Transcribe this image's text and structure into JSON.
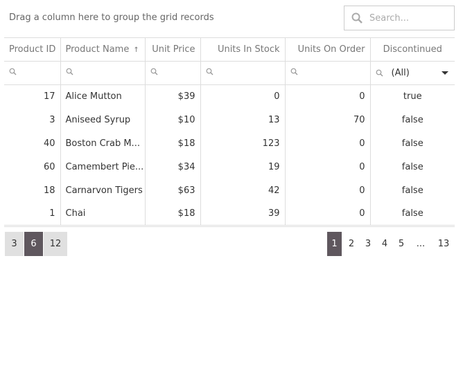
{
  "group_panel": {
    "text": "Drag a column here to group the grid records"
  },
  "search": {
    "placeholder": "Search..."
  },
  "columns": [
    "Product ID",
    "Product Name",
    "Unit Price",
    "Units In Stock",
    "Units On Order",
    "Discontinued"
  ],
  "sort": {
    "column": "Product Name",
    "direction": "ascending"
  },
  "filter": {
    "discontinued": "(All)"
  },
  "rows": [
    [
      "17",
      "Alice Mutton",
      "$39",
      "0",
      "0",
      "true"
    ],
    [
      "3",
      "Aniseed Syrup",
      "$10",
      "13",
      "70",
      "false"
    ],
    [
      "40",
      "Boston Crab M...",
      "$18",
      "123",
      "0",
      "false"
    ],
    [
      "60",
      "Camembert Pie...",
      "$34",
      "19",
      "0",
      "false"
    ],
    [
      "18",
      "Carnarvon Tigers",
      "$63",
      "42",
      "0",
      "false"
    ],
    [
      "1",
      "Chai",
      "$18",
      "39",
      "0",
      "false"
    ]
  ],
  "page_sizes": [
    "3",
    "6",
    "12"
  ],
  "selected_page_size": "6",
  "pages": [
    "1",
    "2",
    "3",
    "4",
    "5",
    "...",
    "13"
  ],
  "current_page": "1",
  "colors": {
    "accent": "#5f575e"
  }
}
